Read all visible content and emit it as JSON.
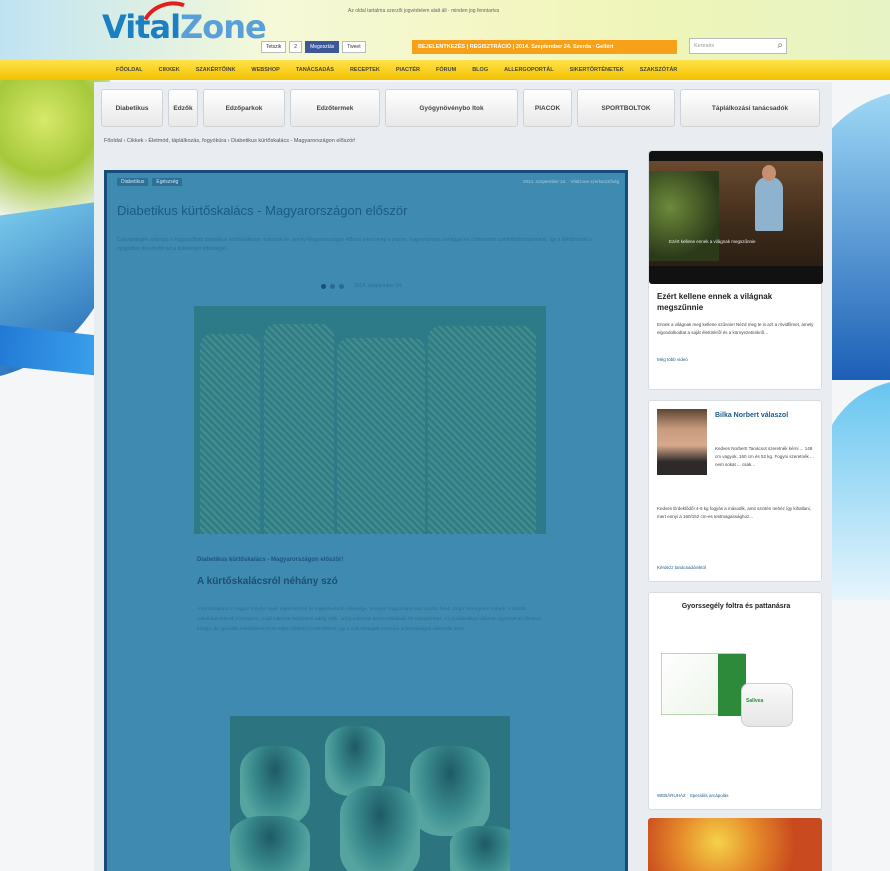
{
  "brand": {
    "logo_part1": "Vital",
    "logo_part2": "Zone"
  },
  "top_note": "Az oldal tartalma szerzői jogvédelem alatt áll · minden jog fenntartva",
  "social": {
    "like": "Tetszik",
    "count": "2",
    "share": "Megosztás",
    "tweet": "Tweet"
  },
  "top_links": "BEJELENTKEZÉS | REGISZTRÁCIÓ | 2014. Szeptember 24. Szerda · Gellért",
  "search": {
    "placeholder": "Keresés"
  },
  "main_nav": [
    "FŐOLDAL",
    "CIKKEK",
    "SZAKÉRTŐINK",
    "WEBSHOP",
    "TANÁCSADÁS",
    "RECEPTEK",
    "PIACTÉR",
    "FÓRUM",
    "BLOG",
    "ALLERGOPORTÁL",
    "SIKERTÖRTÉNETEK",
    "SZAKSZÓTÁR"
  ],
  "category_nav": [
    "Diabetikus",
    "Edzők",
    "Edzőparkok",
    "Edzőtermek",
    "Gyógynövénybo ltok",
    "PIACOK",
    "SPORTBOLTOK",
    "Táplálkozási tanácsadók"
  ],
  "breadcrumb": "Főoldal › Cikkek › Életmód, táplálkozás, fogyókúra › Diabetikus kürtőskalács - Magyarországon először!",
  "article": {
    "tags": [
      "Diabetikus",
      "Egészség"
    ],
    "meta": "2014. szeptember 24. · Vitalzone szerkesztőség",
    "title": "Diabetikus kürtőskalács - Magyarországon először",
    "lead": "Cukorbetegek számára is fogyasztható diabetikus kürtőskalácsot mutatunk be, amely Magyarországon először jelent meg a piacon, hagyományos ízvilággal és csökkentett szénhidráttartalommal, így a diétát tartók is nyugodtan élvezhetik ezt a különleges édességet.",
    "slide_date": "2014. szeptember 24.",
    "subtitle": "Diabetikus kürtőskalács - Magyarországon először!",
    "section_title": "A kürtőskalácsról néhány szó",
    "body": "A kürtőskalács a magyar konyha egyik legismertebb és legkedveltebb édessége, amelyet hagyományosan parázs felett, forgó fahengeren sütnek. A tésztát csíkokban tekerik a hengerre, majd cukorral meghintve addig sütik, amíg a külseje karamellizálódik és ropogós lesz. Az új diabetikus változat ugyanezt az élményt kínálja, de speciális édesítőszerrel és teljes kiőrlésű liszttel készül, így a cukorbetegek számára is biztonságos választás lehet."
  },
  "sidebar": {
    "video_caption": "Ezért kellene ennek a világnak megszűnnie",
    "video_title": "Ezért kellene ennek a világnak megszűnnie",
    "video_text": "Ennek a világnak meg kellene szűnnie! Nézd meg te is azt a rövidfilmet, amely elgondolkodtat a saját életünkről és a környezetünkről...",
    "video_link": "Még több videó",
    "expert_name": "Bilka Norbert válaszol",
    "expert_q": "Kedves Norbert! Tanácsot szeretnék kérni ... 148 cm vagyok, 160 cm és 52 kg. Fogyni szeretnék ... nem sokat ... csak...",
    "expert_a": "Kedves Érdeklődő! 4-6 kg fogyás a második, amit szintén nehéz így kihallani, mert ennyi a 160/152 cm-es testmagassághoz...",
    "expert_link": "Kérdezz tanácsadóinktól",
    "product_title": "Gyorssegély foltra és pattanásra",
    "product_brand": "Sallvea",
    "product_link": "WEBÁRUHÁZ · Speciális arcápolás"
  },
  "colors": {
    "accent": "#f7a11a",
    "nav": "#ffd633",
    "article_overlay": "#3f8ab0",
    "article_border": "#174c78"
  }
}
